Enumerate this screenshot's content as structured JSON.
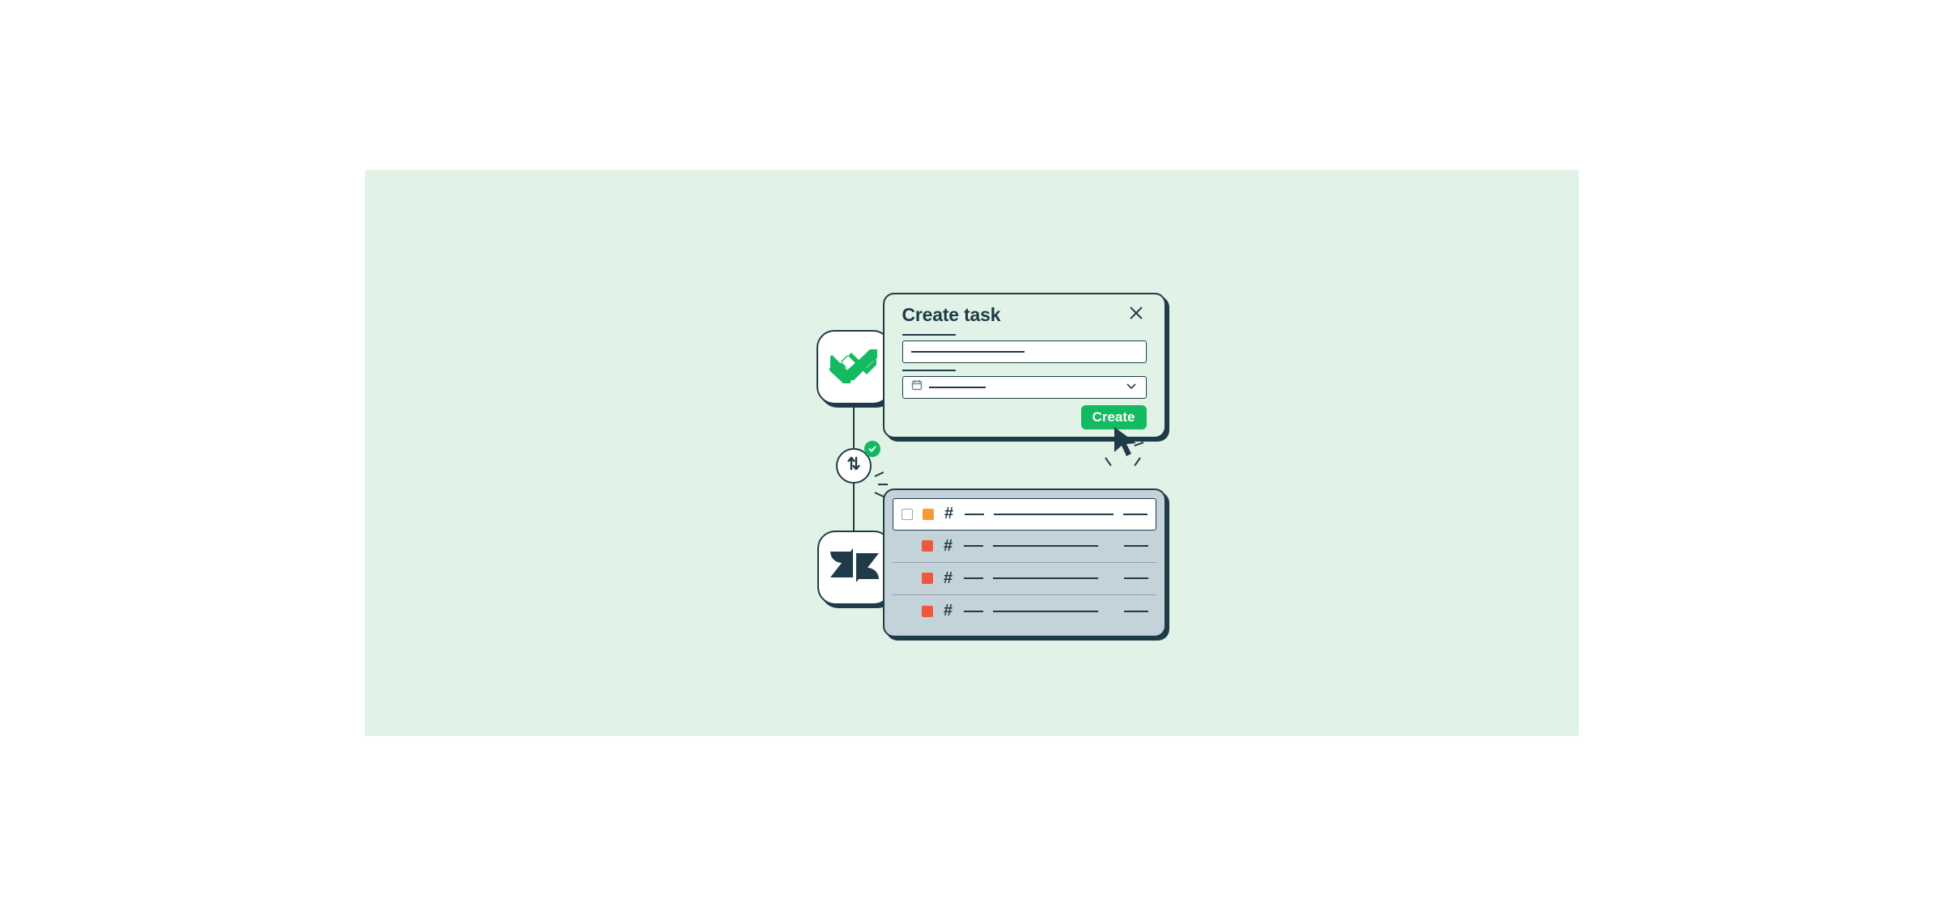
{
  "colors": {
    "bg": "#e1f3e7",
    "border": "#1f3b47",
    "accent": "#14ba5f",
    "status_orange": "#f59b31",
    "status_red": "#eb5a3a",
    "panel_grey": "#c4d3d9"
  },
  "apps": {
    "top_logo_name": "wrike",
    "bottom_logo_name": "zendesk",
    "sync_status": "synced"
  },
  "modal": {
    "title": "Create task",
    "create_label": "Create",
    "close_icon": "close-x",
    "calendar_icon": "calendar",
    "dropdown_icon": "chevron-down"
  },
  "tickets": {
    "header_hash": "#",
    "rows": [
      {
        "active": true,
        "status_color": "#f59b31",
        "checked": false
      },
      {
        "active": false,
        "status_color": "#eb5a3a",
        "checked": false
      },
      {
        "active": false,
        "status_color": "#eb5a3a",
        "checked": false
      },
      {
        "active": false,
        "status_color": "#eb5a3a",
        "checked": false
      }
    ]
  }
}
